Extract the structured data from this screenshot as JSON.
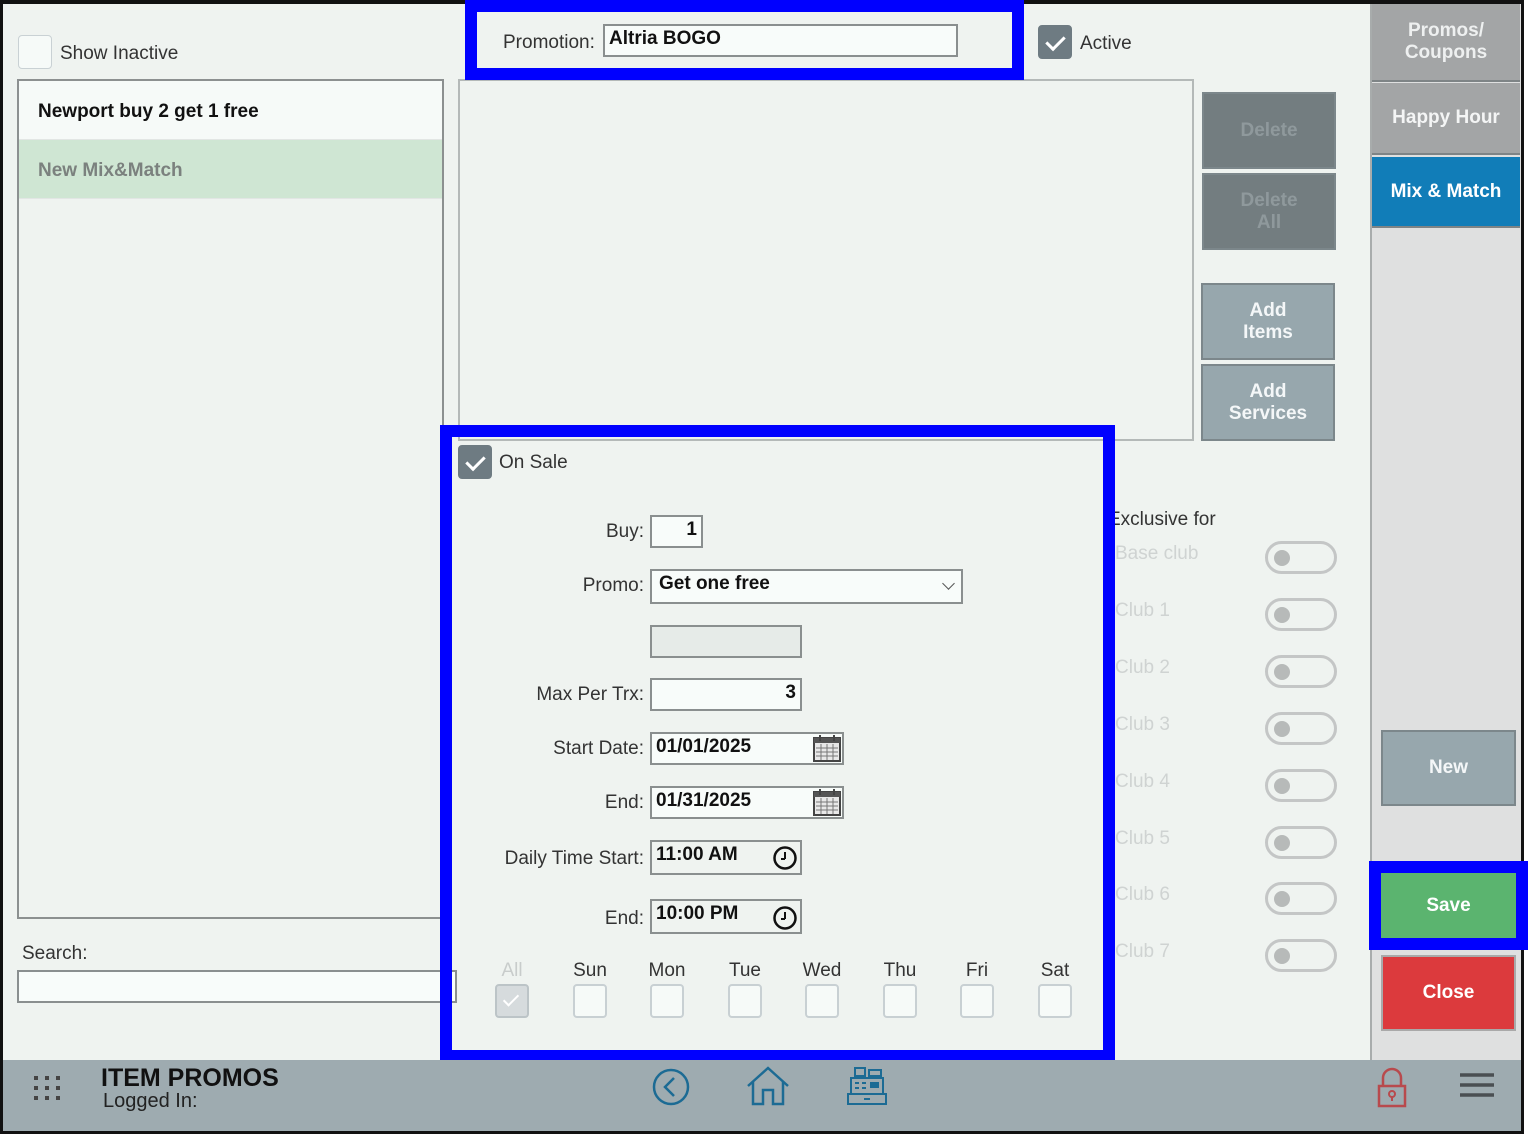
{
  "left_panel": {
    "show_inactive_label": "Show Inactive",
    "show_inactive_checked": false,
    "promotions": [
      {
        "label": "Newport buy 2 get 1 free",
        "selected": false
      },
      {
        "label": "New Mix&Match",
        "selected": true
      }
    ],
    "search_label": "Search:",
    "search_value": ""
  },
  "header": {
    "promotion_label": "Promotion:",
    "promotion_value": "Altria BOGO",
    "active_label": "Active",
    "active_checked": true
  },
  "item_actions": {
    "delete": "Delete",
    "delete_all_line1": "Delete",
    "delete_all_line2": "All",
    "add_items_line1": "Add",
    "add_items_line2": "Items",
    "add_services_line1": "Add",
    "add_services_line2": "Services"
  },
  "sale": {
    "on_sale_label": "On Sale",
    "on_sale_checked": true,
    "buy_label": "Buy:",
    "buy_value": "1",
    "promo_label": "Promo:",
    "promo_value": "Get one free",
    "extra_value": "",
    "max_label": "Max Per Trx:",
    "max_value": "3",
    "start_date_label": "Start Date:",
    "start_date_value": "01/01/2025",
    "end_date_label": "End:",
    "end_date_value": "01/31/2025",
    "time_start_label": "Daily Time Start:",
    "time_start_value": "11:00 AM",
    "time_end_label": "End:",
    "time_end_value": "10:00 PM",
    "days": [
      {
        "label": "All",
        "checked": true,
        "disabled": true
      },
      {
        "label": "Sun",
        "checked": false
      },
      {
        "label": "Mon",
        "checked": false
      },
      {
        "label": "Tue",
        "checked": false
      },
      {
        "label": "Wed",
        "checked": false
      },
      {
        "label": "Thu",
        "checked": false
      },
      {
        "label": "Fri",
        "checked": false
      },
      {
        "label": "Sat",
        "checked": false
      }
    ]
  },
  "exclusive": {
    "title": "Exclusive for",
    "clubs": [
      {
        "label": "Base club",
        "on": false
      },
      {
        "label": "Club 1",
        "on": false
      },
      {
        "label": "Club 2",
        "on": false
      },
      {
        "label": "Club 3",
        "on": false
      },
      {
        "label": "Club 4",
        "on": false
      },
      {
        "label": "Club 5",
        "on": false
      },
      {
        "label": "Club 6",
        "on": false
      },
      {
        "label": "Club 7",
        "on": false
      }
    ]
  },
  "tabs": [
    {
      "line1": "Promos/",
      "line2": "Coupons",
      "active": false
    },
    {
      "line1": "Happy Hour",
      "line2": "",
      "active": false
    },
    {
      "line1": "Mix & Match",
      "line2": "",
      "active": true
    }
  ],
  "actions": {
    "new": "New",
    "save": "Save",
    "close": "Close"
  },
  "footer": {
    "title": "ITEM PROMOS",
    "logged_in": "Logged In:"
  },
  "colors": {
    "accent_tab": "#117db8",
    "save": "#5bb46f",
    "close": "#dc3a3d",
    "highlight_box": "#0000ff",
    "footer": "#9eabb0"
  }
}
